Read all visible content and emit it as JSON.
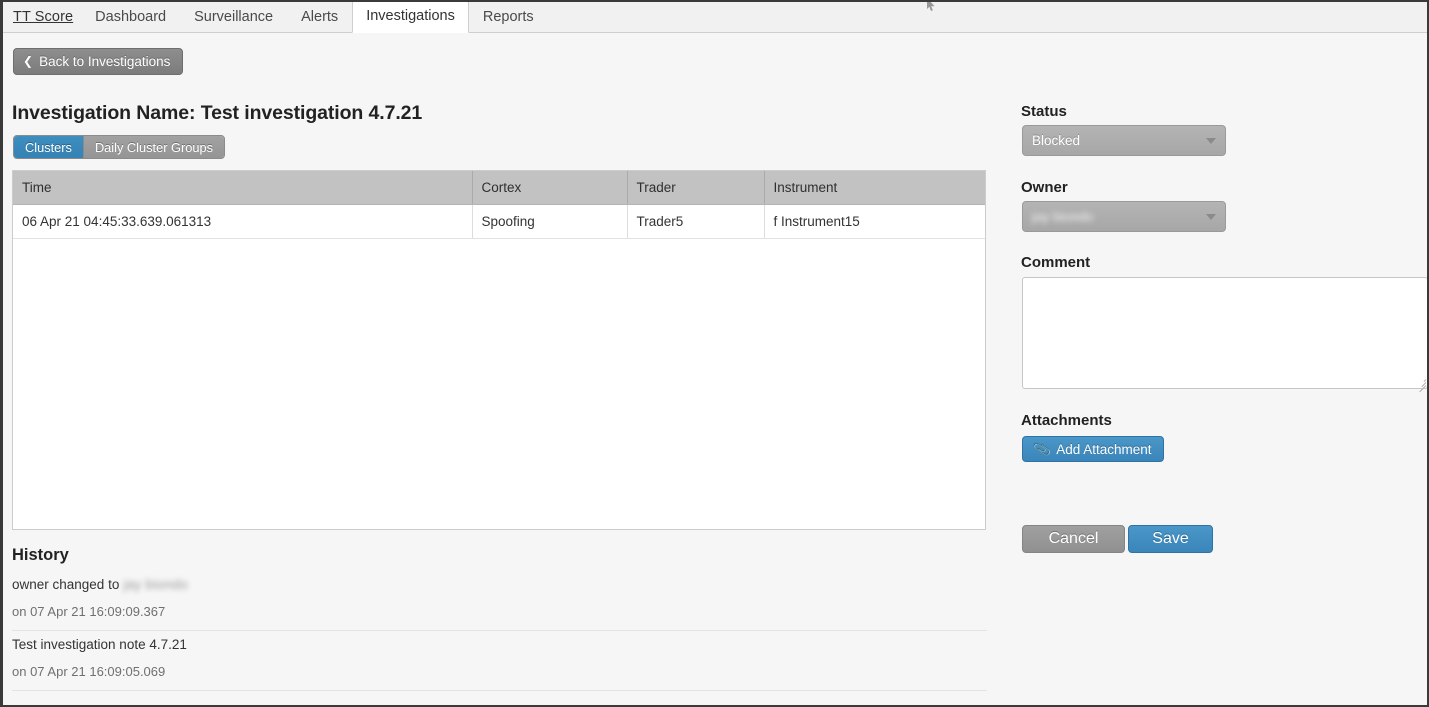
{
  "navbar": {
    "brand": "TT Score",
    "tabs": [
      {
        "label": "Dashboard",
        "active": false
      },
      {
        "label": "Surveillance",
        "active": false
      },
      {
        "label": "Alerts",
        "active": false
      },
      {
        "label": "Investigations",
        "active": true
      },
      {
        "label": "Reports",
        "active": false
      }
    ]
  },
  "toolbar": {
    "back_label": "Back to Investigations",
    "back_chevron": "chevron-left-icon"
  },
  "page": {
    "title": "Investigation Name: Test investigation 4.7.21"
  },
  "segmented": {
    "clusters_label": "Clusters",
    "daily_label": "Daily Cluster Groups",
    "selected": "Clusters"
  },
  "table": {
    "columns": [
      "Time",
      "Cortex",
      "Trader",
      "Instrument"
    ],
    "rows": [
      {
        "time": "06 Apr 21 04:45:33.639.061313",
        "cortex": "Spoofing",
        "trader": "Trader5",
        "instrument": "f Instrument15"
      }
    ]
  },
  "history": {
    "title": "History",
    "entries": [
      {
        "text": "owner changed to",
        "redacted": "jay biondo",
        "date": "on 07 Apr 21 16:09:09.367"
      },
      {
        "text": "Test investigation note 4.7.21",
        "redacted": "",
        "date": "on 07 Apr 21 16:09:05.069"
      }
    ]
  },
  "panel": {
    "status_label": "Status",
    "status_value": "Blocked",
    "owner_label": "Owner",
    "owner_value": "jay biondo",
    "comment_label": "Comment",
    "comment_value": "",
    "comment_placeholder": "",
    "attachments_label": "Attachments",
    "add_attachment_label": "Add Attachment",
    "add_attachment_icon": "paperclip-icon",
    "cancel_label": "Cancel",
    "save_label": "Save"
  },
  "colors": {
    "accent_blue": "#3a85ba",
    "grey_button": "#909090",
    "header_grey": "#c2c2c2",
    "page_bg": "#f6f6f6"
  }
}
